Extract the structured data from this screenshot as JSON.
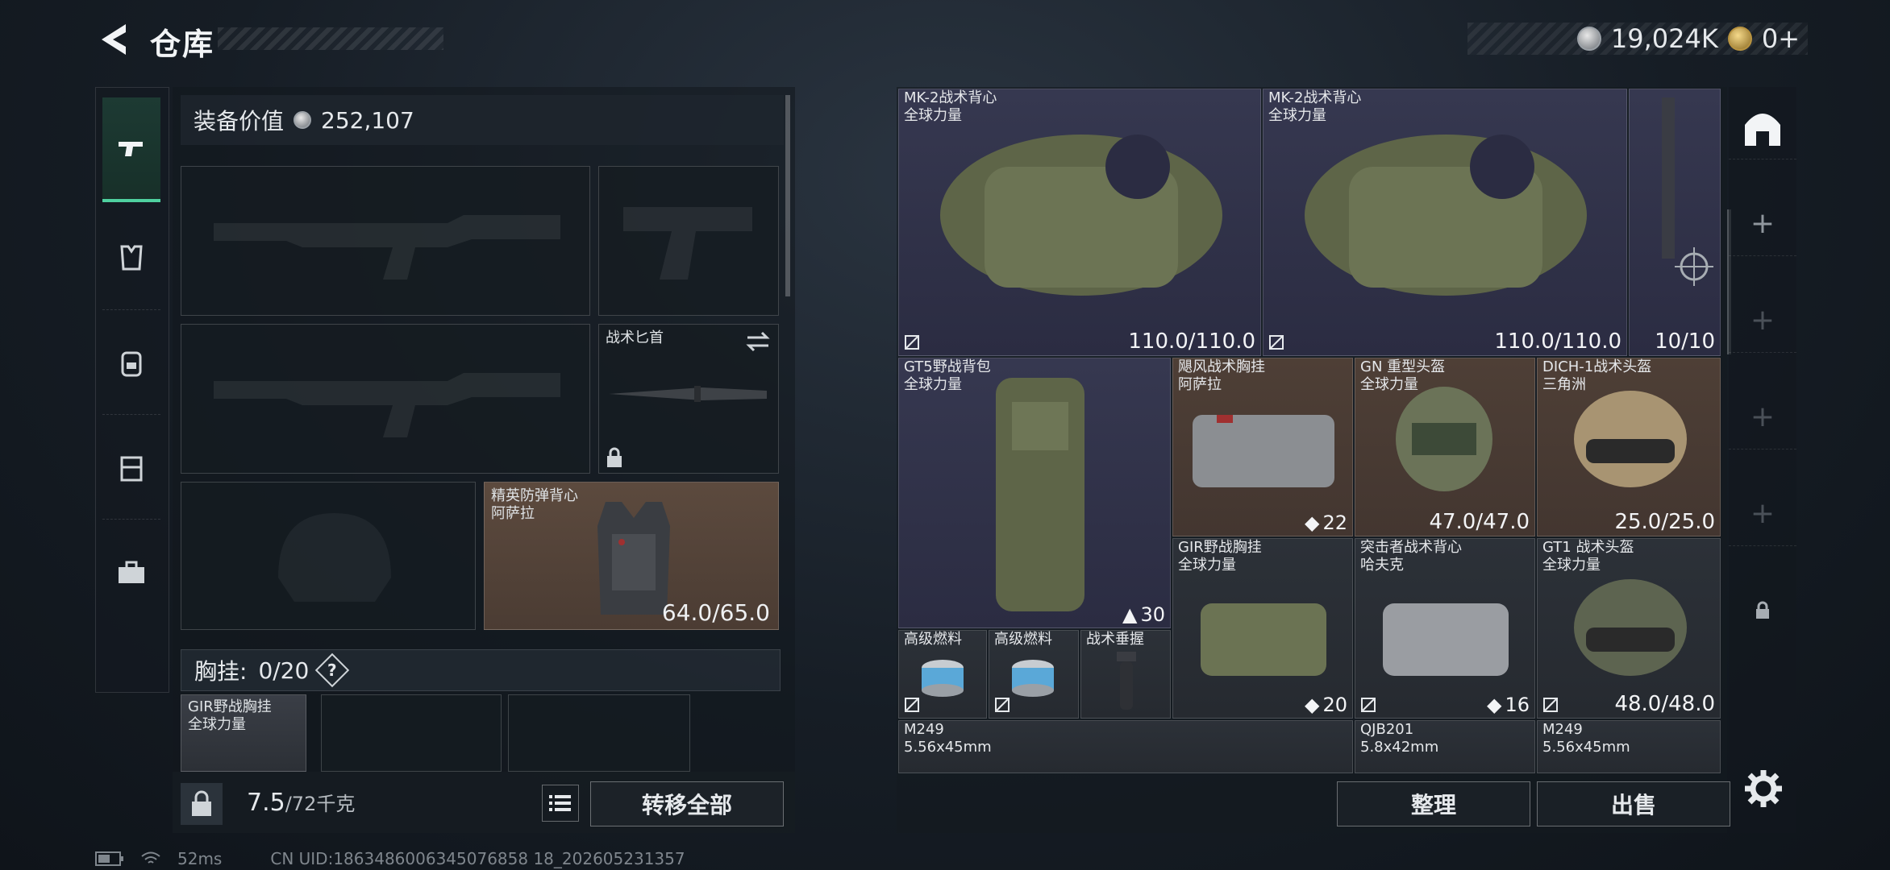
{
  "header": {
    "title": "仓库",
    "currency_silver": "19,024K",
    "currency_gold": "0+"
  },
  "left_tabs": [
    {
      "name": "weapons"
    },
    {
      "name": "armor"
    },
    {
      "name": "backpack"
    },
    {
      "name": "chest-rig"
    },
    {
      "name": "supplies"
    }
  ],
  "equipment": {
    "value_label": "装备价值",
    "value": "252,107",
    "knife_label": "战术匕首",
    "vest_name": "精英防弹背心",
    "vest_location": "阿萨拉",
    "vest_durability": "64.0/65.0",
    "chest_label": "胸挂:",
    "chest_capacity": "0/20",
    "chest_help": "?",
    "chest_item_name": "GIR野战胸挂",
    "chest_item_location": "全球力量"
  },
  "bottom_left": {
    "weight_current": "7.5",
    "weight_max": "/72千克",
    "transfer_all": "转移全部"
  },
  "warehouse": {
    "items": [
      {
        "name": "MK-2战术背心",
        "loc": "全球力量",
        "value": "110.0/110.0"
      },
      {
        "name": "MK-2战术背心",
        "loc": "全球力量",
        "value": "110.0/110.0"
      },
      {
        "name": "",
        "loc": "",
        "value": "10/10"
      },
      {
        "name": "GT5野战背包",
        "loc": "全球力量",
        "value": "30"
      },
      {
        "name": "飓风战术胸挂",
        "loc": "阿萨拉",
        "value": "22"
      },
      {
        "name": "GN 重型头盔",
        "loc": "全球力量",
        "value": "47.0/47.0"
      },
      {
        "name": "DICH-1战术头盔",
        "loc": "三角洲",
        "value": "25.0/25.0"
      },
      {
        "name": "高级燃料",
        "loc": "",
        "value": ""
      },
      {
        "name": "高级燃料",
        "loc": "",
        "value": ""
      },
      {
        "name": "战术垂握",
        "loc": "",
        "value": ""
      },
      {
        "name": "GIR野战胸挂",
        "loc": "全球力量",
        "value": "20"
      },
      {
        "name": "突击者战术背心",
        "loc": "哈夫克",
        "value": "16"
      },
      {
        "name": "GT1 战术头盔",
        "loc": "全球力量",
        "value": "48.0/48.0"
      },
      {
        "name": "M249",
        "loc": "5.56x45mm",
        "value": ""
      },
      {
        "name": "QJB201",
        "loc": "5.8x42mm",
        "value": ""
      },
      {
        "name": "M249",
        "loc": "5.56x45mm",
        "value": ""
      }
    ],
    "sort_label": "整理",
    "sell_label": "出售"
  },
  "status": {
    "ping": "52ms",
    "uid": "CN UID:1863486006345076858 18_202605231357"
  },
  "colors": {
    "accent_green": "#4fd1a0",
    "slot_brown": "#5c4a3e",
    "cell_purple": "#363850"
  }
}
